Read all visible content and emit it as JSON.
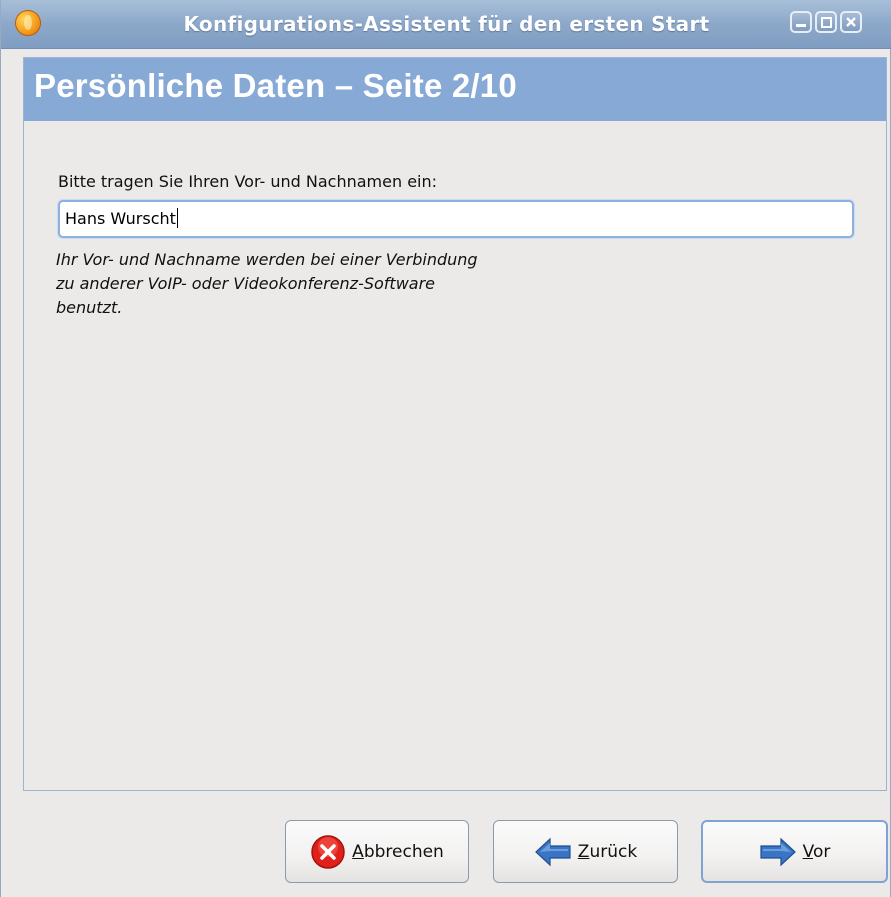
{
  "window": {
    "title": "Konfigurations-Assistent für den ersten Start",
    "controls": [
      "minimize-icon",
      "maximize-icon",
      "close-icon"
    ]
  },
  "page": {
    "heading": "Persönliche Daten – Seite 2/10",
    "name_label": "Bitte tragen Sie Ihren Vor- und Nachnamen ein:",
    "name_value": "Hans Wurscht",
    "hint_lines": [
      "Ihr Vor- und Nachname werden bei einer Verbindung",
      "zu anderer VoIP- oder Videokonferenz-Software",
      "benutzt."
    ]
  },
  "buttons": {
    "cancel": {
      "mnemonic": "A",
      "rest": "bbrechen",
      "icon": "cancel-icon"
    },
    "back": {
      "mnemonic": "Z",
      "rest": "urück",
      "icon": "arrow-left-icon"
    },
    "next": {
      "mnemonic": "V",
      "rest": "or",
      "icon": "arrow-right-icon"
    }
  },
  "colors": {
    "titlebar": "#8ca8c9",
    "header_band": "#87a9d6",
    "input_border": "#8db0dc",
    "cancel_icon": "#e0211b",
    "arrow_icon": "#3a74c4"
  }
}
